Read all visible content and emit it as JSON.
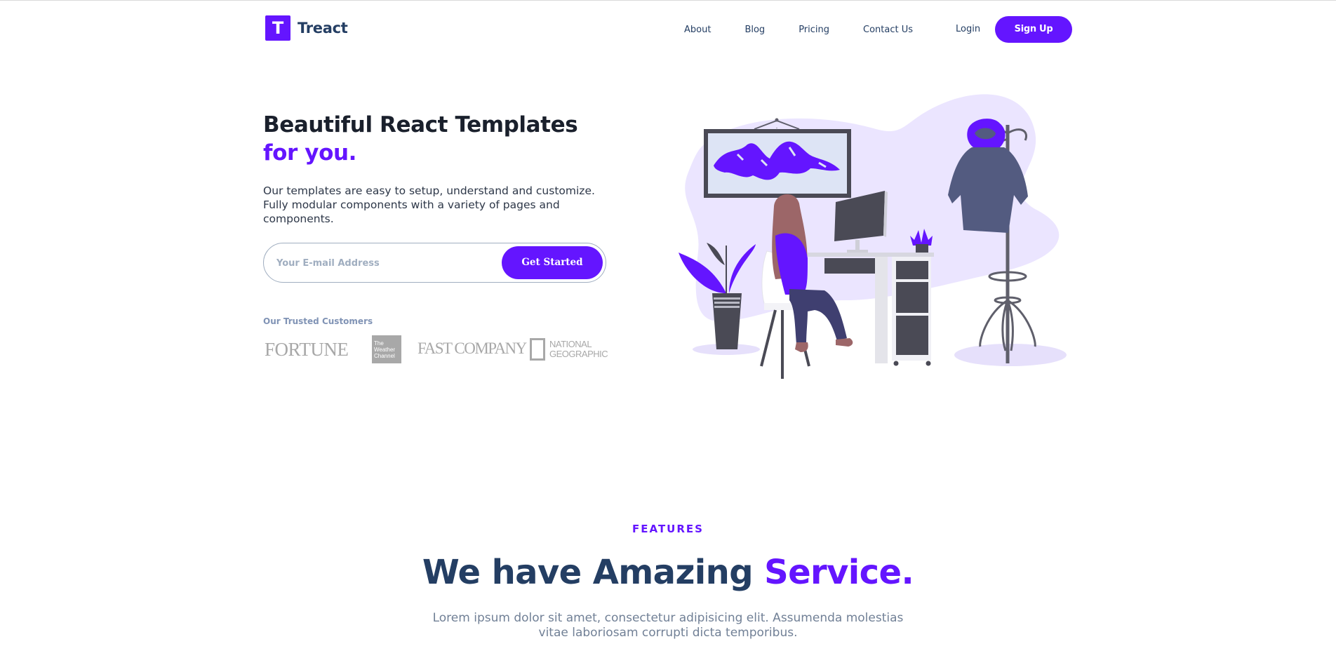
{
  "header": {
    "logo_letter": "T",
    "brand": "Treact",
    "nav": [
      "About",
      "Blog",
      "Pricing",
      "Contact Us"
    ],
    "login": "Login",
    "signup": "Sign Up"
  },
  "hero": {
    "title_main": "Beautiful React Templates ",
    "title_accent": "for you.",
    "description": "Our templates are easy to setup, understand and customize. Fully modular components with a variety of pages and components.",
    "email_placeholder": "Your E-mail Address",
    "cta": "Get Started",
    "trusted_label": "Our Trusted Customers",
    "customers": {
      "fortune": "FORTUNE",
      "weather": [
        "The",
        "Weather",
        "Channel"
      ],
      "fast_company": "FAST COMPANY",
      "natgeo": [
        "NATIONAL",
        "GEOGRAPHIC"
      ]
    }
  },
  "features": {
    "label": "FEATURES",
    "title_main": "We have Amazing ",
    "title_accent": "Service.",
    "description": "Lorem ipsum dolor sit amet, consectetur adipisicing elit. Assumenda molestias vitae laboriosam corrupti dicta temporibus."
  },
  "colors": {
    "primary": "#6415ff",
    "heading": "#243e63",
    "muted": "#718096",
    "illustration_bg": "#ebe5ff",
    "illustration_dark": "#4a4a55"
  }
}
